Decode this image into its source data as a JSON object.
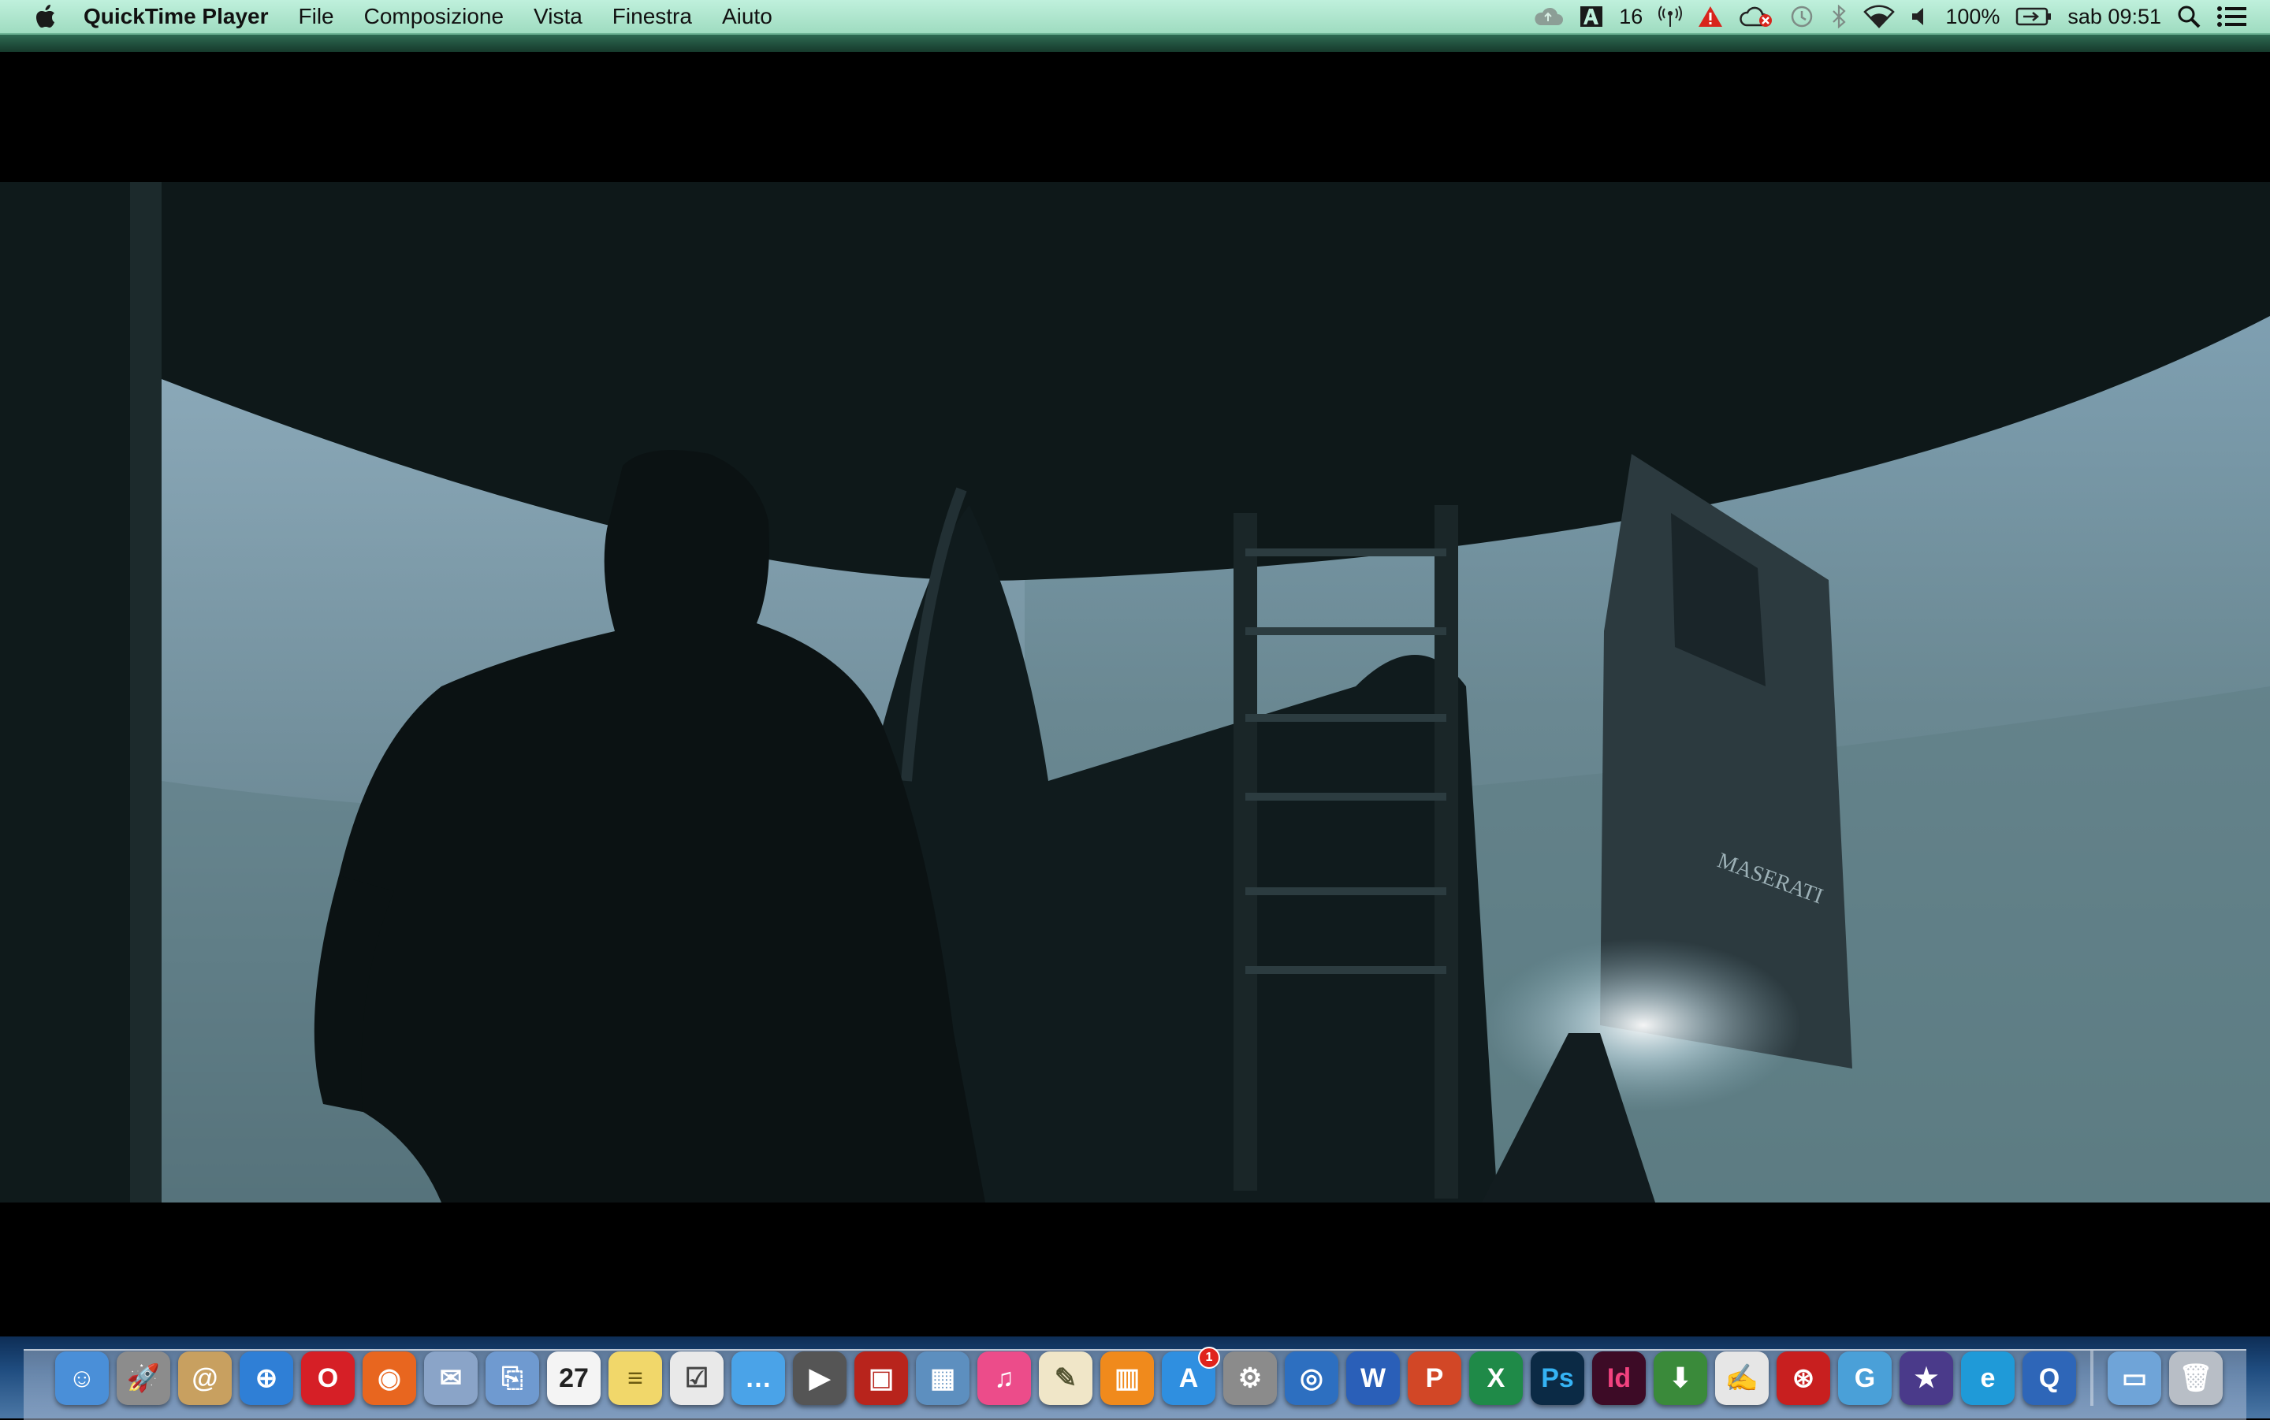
{
  "menubar": {
    "app_name": "QuickTime Player",
    "menus": [
      "File",
      "Composizione",
      "Vista",
      "Finestra",
      "Aiuto"
    ],
    "status": {
      "adobe_count": "16",
      "battery": "100%",
      "clock": "sab 09:51"
    },
    "status_icons": [
      "cloud-icon",
      "adobe-icon",
      "wireless-antenna-icon",
      "warning-icon",
      "cloud-error-icon",
      "time-machine-icon",
      "bluetooth-icon",
      "wifi-icon",
      "volume-icon",
      "battery-icon",
      "spotlight-icon",
      "notification-center-icon"
    ]
  },
  "video": {
    "title": "QuickTime video playback",
    "car_brand_text": "MASERATI"
  },
  "dock": {
    "apps": [
      {
        "name": "Finder",
        "color": "#4a8fd8",
        "glyph": "☺"
      },
      {
        "name": "Launchpad",
        "color": "#8c8c8c",
        "glyph": "🚀"
      },
      {
        "name": "Contacts",
        "color": "#c8a060",
        "glyph": "@"
      },
      {
        "name": "Safari",
        "color": "#2f7fd6",
        "glyph": "⊕"
      },
      {
        "name": "Opera",
        "color": "#d61f26",
        "glyph": "O"
      },
      {
        "name": "Firefox",
        "color": "#e8661f",
        "glyph": "◉"
      },
      {
        "name": "Mail",
        "color": "#8aa4c8",
        "glyph": "✉"
      },
      {
        "name": "Preview",
        "color": "#6f9ad0",
        "glyph": "⎘"
      },
      {
        "name": "Calendar",
        "color": "#f4f4f4",
        "glyph": "27",
        "text": "#222"
      },
      {
        "name": "Notes",
        "color": "#f1d76a",
        "glyph": "≡",
        "text": "#6b5a10"
      },
      {
        "name": "Reminders",
        "color": "#e9e9e9",
        "glyph": "☑",
        "text": "#444"
      },
      {
        "name": "Messages",
        "color": "#4aa3e8",
        "glyph": "…"
      },
      {
        "name": "FaceTime",
        "color": "#555",
        "glyph": "▶"
      },
      {
        "name": "Photo Booth",
        "color": "#b8241c",
        "glyph": "▣"
      },
      {
        "name": "iPhoto",
        "color": "#5d8fbf",
        "glyph": "▦"
      },
      {
        "name": "iTunes",
        "color": "#ec4c8a",
        "glyph": "♫"
      },
      {
        "name": "TextEdit",
        "color": "#f0e6c8",
        "glyph": "✎",
        "text": "#553"
      },
      {
        "name": "iBooks",
        "color": "#f08a1c",
        "glyph": "▥"
      },
      {
        "name": "App Store",
        "color": "#2f8fe0",
        "glyph": "A",
        "badge": "1"
      },
      {
        "name": "System Preferences",
        "color": "#8b8b8b",
        "glyph": "⚙"
      },
      {
        "name": "Xscope",
        "color": "#2d6fc0",
        "glyph": "◎"
      },
      {
        "name": "Word",
        "color": "#2a5fb8",
        "glyph": "W"
      },
      {
        "name": "PowerPoint",
        "color": "#d24726",
        "glyph": "P"
      },
      {
        "name": "Excel",
        "color": "#1f8a48",
        "glyph": "X"
      },
      {
        "name": "Photoshop",
        "color": "#0b2a45",
        "glyph": "Ps",
        "text": "#35b3f4"
      },
      {
        "name": "InDesign",
        "color": "#3d0b26",
        "glyph": "Id",
        "text": "#f2427f"
      },
      {
        "name": "Transmit",
        "color": "#3a8a3a",
        "glyph": "⬇"
      },
      {
        "name": "Script Editor",
        "color": "#e6e6e6",
        "glyph": "✍",
        "text": "#444"
      },
      {
        "name": "Network Utility",
        "color": "#c81f1f",
        "glyph": "⊛"
      },
      {
        "name": "Gravit",
        "color": "#4aa0d8",
        "glyph": "G"
      },
      {
        "name": "iMovie",
        "color": "#4a3a8a",
        "glyph": "★"
      },
      {
        "name": "Explorer",
        "color": "#1f9ad8",
        "glyph": "e"
      },
      {
        "name": "QuickTime Player",
        "color": "#2e66b8",
        "glyph": "Q"
      }
    ],
    "right": [
      {
        "name": "Downloads folder",
        "color": "#6fa4d8",
        "glyph": "▭"
      },
      {
        "name": "Trash",
        "color": "#b8bec6",
        "glyph": "🗑"
      }
    ]
  }
}
